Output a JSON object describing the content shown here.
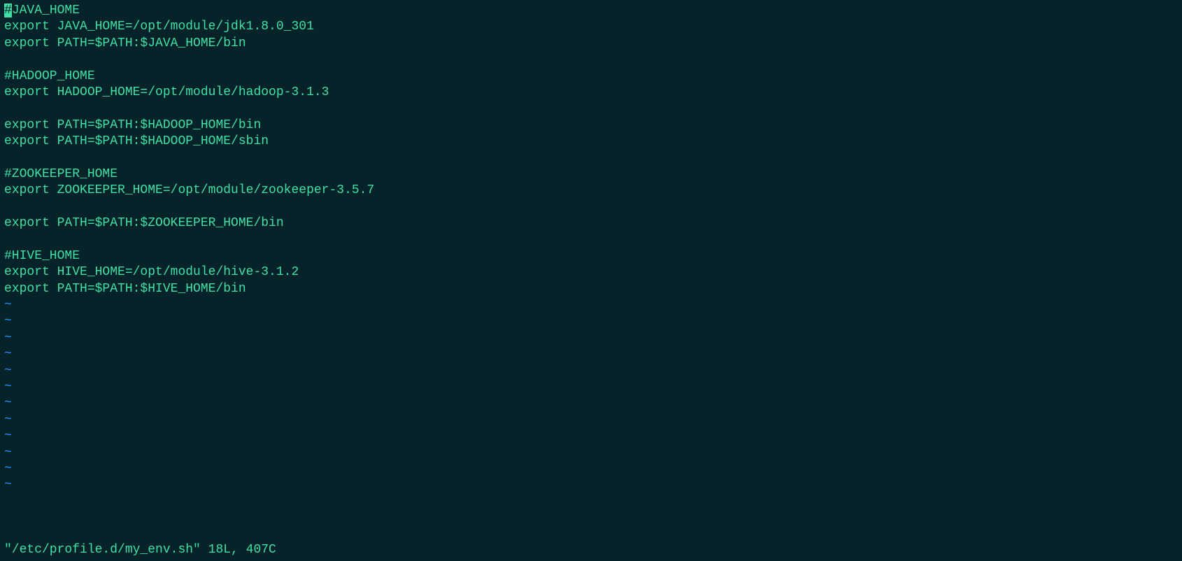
{
  "cursor_char": "#",
  "line1_rest": "JAVA_HOME",
  "lines": [
    "export JAVA_HOME=/opt/module/jdk1.8.0_301",
    "export PATH=$PATH:$JAVA_HOME/bin",
    "",
    "#HADOOP_HOME",
    "export HADOOP_HOME=/opt/module/hadoop-3.1.3",
    "",
    "export PATH=$PATH:$HADOOP_HOME/bin",
    "export PATH=$PATH:$HADOOP_HOME/sbin",
    "",
    "#ZOOKEEPER_HOME",
    "export ZOOKEEPER_HOME=/opt/module/zookeeper-3.5.7",
    "",
    "export PATH=$PATH:$ZOOKEEPER_HOME/bin",
    "",
    "#HIVE_HOME",
    "export HIVE_HOME=/opt/module/hive-3.1.2",
    "export PATH=$PATH:$HIVE_HOME/bin"
  ],
  "tilde": "~",
  "status": "\"/etc/profile.d/my_env.sh\" 18L, 407C"
}
